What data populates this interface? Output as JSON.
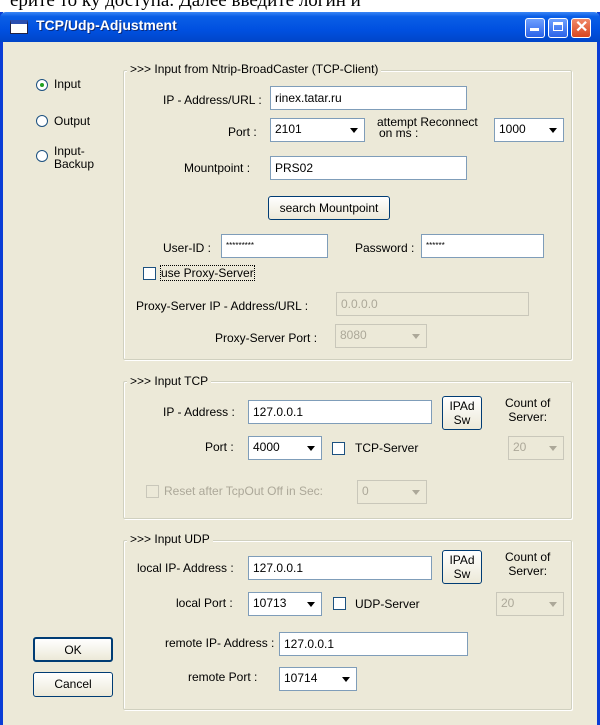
{
  "overlay_text": "ерите то ку доступа. Далее введите логин и",
  "window": {
    "title": "TCP/Udp-Adjustment"
  },
  "mode": {
    "options": [
      {
        "label": "Input",
        "selected": true
      },
      {
        "label": "Output",
        "selected": false
      },
      {
        "label": "Input-Backup",
        "selected": false
      }
    ]
  },
  "ntrip": {
    "legend": ">>> Input from Ntrip-BroadCaster (TCP-Client)",
    "ip_label": "IP - Address/URL :",
    "ip_value": "rinex.tatar.ru",
    "port_label": "Port :",
    "port_value": "2101",
    "reconnect_label_1": "attempt Reconnect",
    "reconnect_label_2": "on ms :",
    "reconnect_value": "1000",
    "mountpoint_label": "Mountpoint :",
    "mountpoint_value": "PRS02",
    "search_button": "search Mountpoint",
    "userid_label": "User-ID :",
    "userid_value": "*********",
    "password_label": "Password :",
    "password_value": "******",
    "proxy_check_label": "use Proxy-Server",
    "proxy_check_checked": false,
    "proxy_ip_label": "Proxy-Server IP - Address/URL :",
    "proxy_ip_value": "0.0.0.0",
    "proxy_port_label": "Proxy-Server Port :",
    "proxy_port_value": "8080"
  },
  "tcp": {
    "legend": ">>> Input TCP",
    "ip_label": "IP - Address :",
    "ip_value": "127.0.0.1",
    "ipad_btn_1": "IPAd",
    "ipad_btn_2": "Sw",
    "count_label_1": "Count of",
    "count_label_2": "Server:",
    "port_label": "Port :",
    "port_value": "4000",
    "server_check_label": "TCP-Server",
    "count_value": "20",
    "reset_label": "Reset after TcpOut Off in Sec:",
    "reset_value": "0"
  },
  "udp": {
    "legend": ">>> Input UDP",
    "local_ip_label": "local IP- Address :",
    "local_ip_value": "127.0.0.1",
    "ipad_btn_1": "IPAd",
    "ipad_btn_2": "Sw",
    "count_label_1": "Count of",
    "count_label_2": "Server:",
    "local_port_label": "local Port :",
    "local_port_value": "10713",
    "server_check_label": "UDP-Server",
    "count_value": "20",
    "remote_ip_label": "remote IP- Address :",
    "remote_ip_value": "127.0.0.1",
    "remote_port_label": "remote Port :",
    "remote_port_value": "10714"
  },
  "buttons": {
    "ok": "OK",
    "cancel": "Cancel"
  }
}
